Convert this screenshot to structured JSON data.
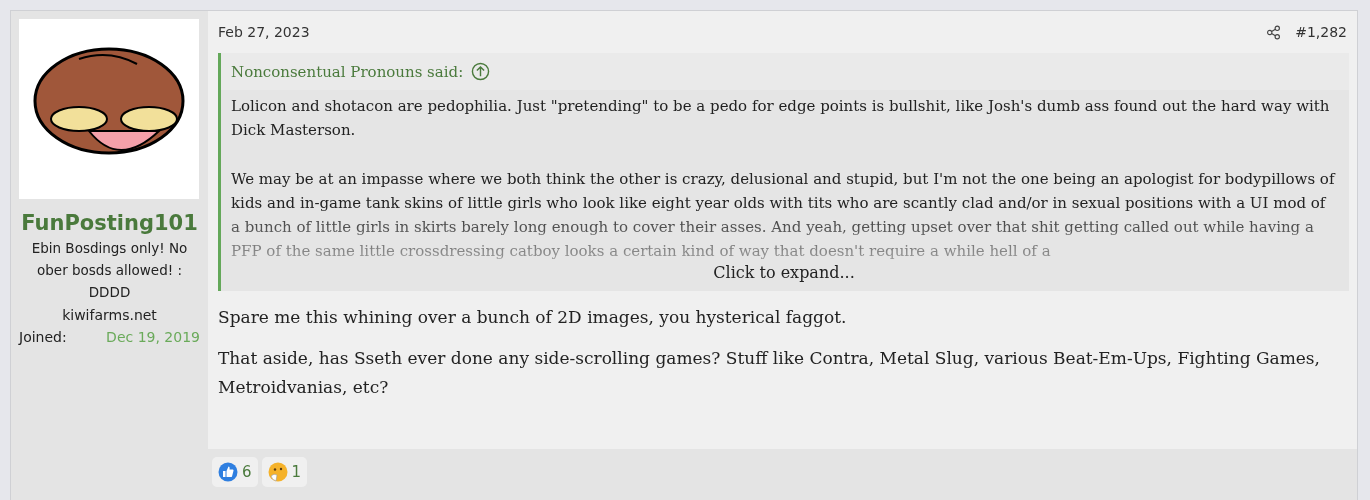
{
  "user": {
    "name": "FunPosting101",
    "title": "Ebin Bosdings only! No ober bosds allowed! : DDDD",
    "banner": "kiwifarms.net",
    "joined_label": "Joined:",
    "joined_date": "Dec 19, 2019"
  },
  "post": {
    "date": "Feb 27, 2023",
    "number": "#1,282",
    "quote": {
      "author": "Nonconsentual Pronouns said:",
      "paragraphs": [
        "Lolicon and shotacon are pedophilia. Just \"pretending\" to be a pedo for edge points is bullshit, like Josh's dumb ass found out the hard way with Dick Masterson.",
        "We may be at an impasse where we both think the other is crazy, delusional and stupid, but I'm not the one being an apologist for bodypillows of kids and in-game tank skins of little girls who look like eight year olds with tits who are scantly clad and/or in sexual positions with a UI mod of a bunch of little girls in skirts barely long enough to cover their asses. And yeah, getting upset over that shit getting called out while having a PFP of the same little crossdressing catboy looks a certain kind of way that doesn't require a while hell of a"
      ],
      "expand": "Click to expand..."
    },
    "body": [
      "Spare me this whining over a bunch of 2D images, you hysterical faggot.",
      "That aside, has Sseth ever done any side-scrolling games? Stuff like Contra, Metal Slug, various Beat-Em-Ups, Fighting Games, Metroidvanias, etc?"
    ],
    "reactions": [
      {
        "kind": "like",
        "count": "6"
      },
      {
        "kind": "thinking",
        "count": "1"
      }
    ]
  }
}
